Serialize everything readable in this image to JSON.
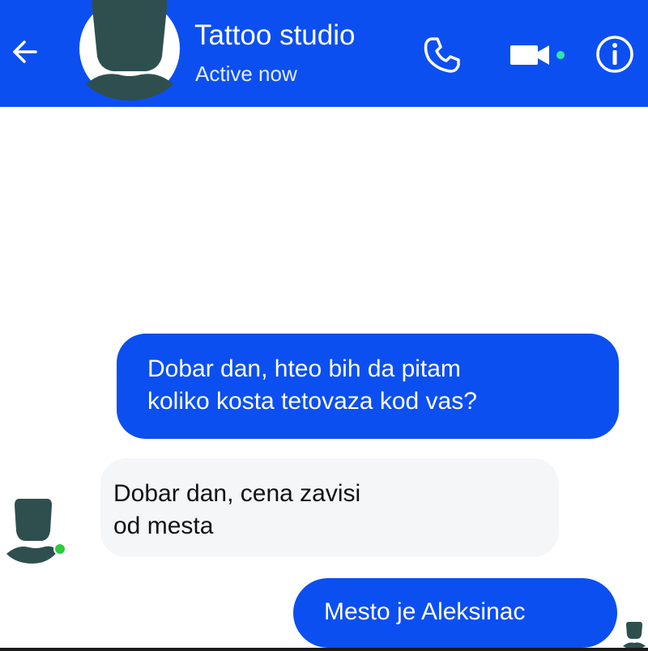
{
  "header": {
    "contact_name": "Tattoo studio",
    "status": "Active now",
    "background_color": "#0c4ff0",
    "back_icon": "arrow-left-icon",
    "call_icon": "phone-icon",
    "video_icon": "video-camera-icon",
    "info_icon": "info-icon",
    "video_active_dot_color": "#2ee6a8"
  },
  "messages": [
    {
      "direction": "outgoing",
      "lines": [
        "Dobar dan, hteo bih da pitam",
        "koliko kosta tetovaza kod vas?"
      ]
    },
    {
      "direction": "incoming",
      "lines": [
        "Dobar dan, cena zavisi",
        "od mesta"
      ]
    },
    {
      "direction": "outgoing",
      "lines": [
        "Mesto je Aleksinac"
      ]
    }
  ],
  "colors": {
    "outgoing_bubble": "#0c4ff0",
    "incoming_bubble": "#f5f6f8",
    "online_dot": "#2ecc40",
    "avatar_silhouette": "#2f4f4f"
  }
}
